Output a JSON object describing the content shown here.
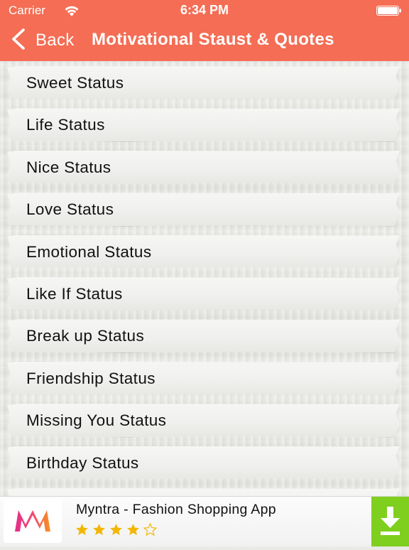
{
  "status_bar": {
    "carrier": "Carrier",
    "time": "6:34 PM"
  },
  "nav": {
    "back_label": "Back",
    "title": "Motivational Staust & Quotes"
  },
  "categories": [
    "Sweet Status",
    "Life Status",
    "Nice Status",
    "Love Status",
    "Emotional Status",
    "Like If Status",
    "Break up Status",
    "Friendship Status",
    "Missing You Status",
    "Birthday Status",
    ""
  ],
  "ad": {
    "title": "Myntra - Fashion Shopping App",
    "rating": 4,
    "rating_max": 5
  },
  "colors": {
    "accent": "#f46d54",
    "download": "#7fcf1f",
    "star": "#f2b705",
    "logo_gradient_start": "#e52c8a",
    "logo_gradient_end": "#f7931e"
  },
  "icons": {
    "wifi": "wifi-icon",
    "battery": "battery-icon",
    "back": "chevron-left-icon",
    "download": "download-icon",
    "logo": "myntra-logo-icon"
  }
}
